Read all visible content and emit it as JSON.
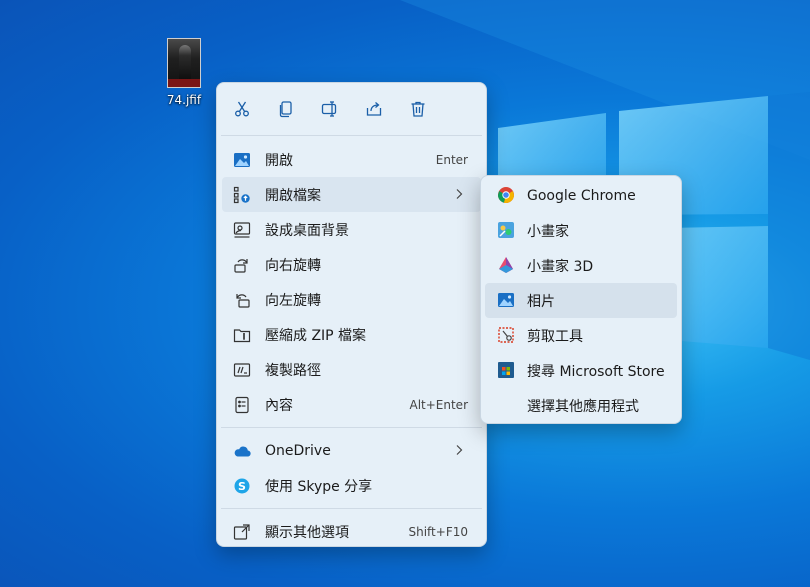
{
  "desktop": {
    "file": {
      "name": "74.jfif",
      "icon": "image-thumbnail-icon"
    }
  },
  "context_menu": {
    "toolbar": [
      {
        "name": "cut",
        "icon": "scissors-icon"
      },
      {
        "name": "copy",
        "icon": "copy-icon"
      },
      {
        "name": "rename",
        "icon": "rename-icon"
      },
      {
        "name": "share",
        "icon": "share-icon"
      },
      {
        "name": "delete",
        "icon": "trash-icon"
      }
    ],
    "items": [
      {
        "label": "開啟",
        "shortcut": "Enter",
        "icon": "photo-icon"
      },
      {
        "label": "開啟檔案",
        "icon": "open-with-icon",
        "has_submenu": true
      },
      {
        "label": "設成桌面背景",
        "icon": "wallpaper-icon"
      },
      {
        "label": "向右旋轉",
        "icon": "rotate-right-icon"
      },
      {
        "label": "向左旋轉",
        "icon": "rotate-left-icon"
      },
      {
        "label": "壓縮成 ZIP 檔案",
        "icon": "zip-icon"
      },
      {
        "label": "複製路徑",
        "icon": "copy-path-icon"
      },
      {
        "label": "內容",
        "shortcut": "Alt+Enter",
        "icon": "properties-icon"
      },
      {
        "label": "OneDrive",
        "icon": "onedrive-icon",
        "has_submenu": true
      },
      {
        "label": "使用 Skype 分享",
        "icon": "skype-icon"
      },
      {
        "label": "顯示其他選項",
        "shortcut": "Shift+F10",
        "icon": "more-options-icon"
      }
    ]
  },
  "submenu": {
    "items": [
      {
        "label": "Google Chrome",
        "icon": "chrome-icon"
      },
      {
        "label": "小畫家",
        "icon": "paint-icon"
      },
      {
        "label": "小畫家 3D",
        "icon": "paint-3d-icon"
      },
      {
        "label": "相片",
        "icon": "photos-icon"
      },
      {
        "label": "剪取工具",
        "icon": "snipping-tool-icon"
      },
      {
        "label": "搜尋 Microsoft Store",
        "icon": "microsoft-store-icon"
      },
      {
        "label": "選擇其他應用程式",
        "icon": ""
      }
    ]
  },
  "colors": {
    "desktop_blue": "#0a78d8",
    "menu_bg": "#e6f0f8",
    "hover_bg": "#d9e5f0",
    "accent": "#1a73c9"
  }
}
